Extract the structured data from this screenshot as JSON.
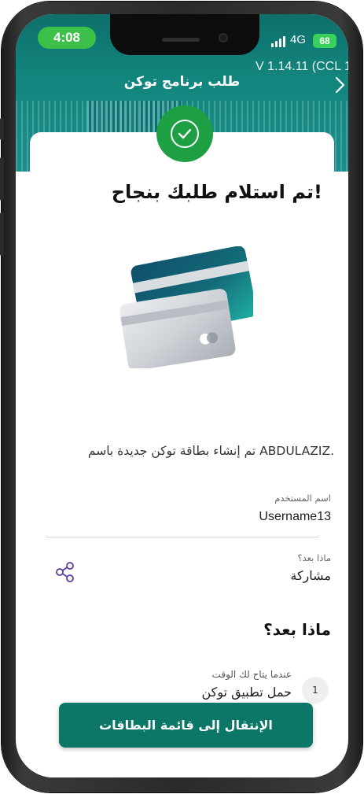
{
  "status_bar": {
    "time": "4:08",
    "network": "4G",
    "battery": "68"
  },
  "header": {
    "version": "V 1.14.11 (CCL 1",
    "title": "طلب برنامج توكن"
  },
  "confirmation": {
    "title": "تم استلام طلبك بنجاح!",
    "message": "تم إنشاء بطاقة توكن جديدة باسم ABDULAZIZ."
  },
  "details": {
    "username_label": "اسم المستخدم",
    "username_value": "Username13",
    "share_label": "ماذا بعد؟",
    "share_value": "مشاركة"
  },
  "next_steps": {
    "title": "ماذا بعد؟",
    "steps": [
      {
        "number": "1",
        "label": "عندما يتاح لك الوقت",
        "value": "حمل تطبيق توكن"
      }
    ]
  },
  "cta": {
    "label": "الإنتقال إلى قائمة البطاقات"
  },
  "colors": {
    "accent": "#0d7767",
    "success": "#1f9f44",
    "header": "#12857d"
  }
}
